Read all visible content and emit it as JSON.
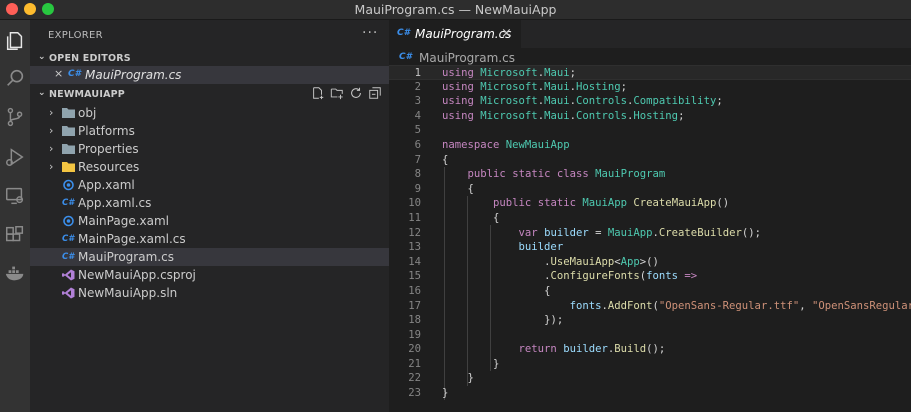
{
  "window": {
    "title": "MauiProgram.cs — NewMauiApp"
  },
  "sidebar": {
    "header": "EXPLORER",
    "more": "···",
    "open_editors": {
      "label": "OPEN EDITORS",
      "items": [
        {
          "badge": "C#",
          "name": "MauiProgram.cs"
        }
      ]
    },
    "project": {
      "label": "NEWMAUIAPP",
      "items": [
        {
          "name": "obj",
          "kind": "folder"
        },
        {
          "name": "Platforms",
          "kind": "folder"
        },
        {
          "name": "Properties",
          "kind": "folder"
        },
        {
          "name": "Resources",
          "kind": "folder-yellow"
        },
        {
          "name": "App.xaml",
          "kind": "xaml"
        },
        {
          "name": "App.xaml.cs",
          "kind": "cs",
          "badge": "C#"
        },
        {
          "name": "MainPage.xaml",
          "kind": "xaml"
        },
        {
          "name": "MainPage.xaml.cs",
          "kind": "cs",
          "badge": "C#"
        },
        {
          "name": "MauiProgram.cs",
          "kind": "cs",
          "badge": "C#",
          "selected": true
        },
        {
          "name": "NewMauiApp.csproj",
          "kind": "vs"
        },
        {
          "name": "NewMauiApp.sln",
          "kind": "vs"
        }
      ]
    }
  },
  "editor": {
    "tab": {
      "badge": "C#",
      "name": "MauiProgram.cs",
      "close": "×"
    },
    "breadcrumb": {
      "badge": "C#",
      "name": "MauiProgram.cs"
    },
    "current_line": 1,
    "lines": [
      "1",
      "2",
      "3",
      "4",
      "5",
      "6",
      "7",
      "8",
      "9",
      "10",
      "11",
      "12",
      "13",
      "14",
      "15",
      "16",
      "17",
      "18",
      "19",
      "20",
      "21",
      "22",
      "23"
    ],
    "code": {
      "l1": [
        "using",
        "Microsoft",
        ".",
        "Maui",
        ";"
      ],
      "l2": [
        "using",
        "Microsoft",
        ".",
        "Maui",
        ".",
        "Hosting",
        ";"
      ],
      "l3": [
        "using",
        "Microsoft",
        ".",
        "Maui",
        ".",
        "Controls",
        ".",
        "Compatibility",
        ";"
      ],
      "l4": [
        "using",
        "Microsoft",
        ".",
        "Maui",
        ".",
        "Controls",
        ".",
        "Hosting",
        ";"
      ],
      "l6": [
        "namespace",
        "NewMauiApp"
      ],
      "l7": "{",
      "l8": [
        "public",
        "static",
        "class",
        "MauiProgram"
      ],
      "l9": "{",
      "l10": [
        "public",
        "static",
        "MauiApp",
        "CreateMauiApp",
        "()"
      ],
      "l11": "{",
      "l12": [
        "var",
        "builder",
        " = ",
        "MauiApp",
        ".",
        "CreateBuilder",
        "();"
      ],
      "l13": "builder",
      "l14": [
        ".",
        "UseMauiApp",
        "<",
        "App",
        ">()"
      ],
      "l15": [
        ".",
        "ConfigureFonts",
        "(",
        "fonts",
        " =>"
      ],
      "l16": "{",
      "l17": [
        "fonts",
        ".",
        "AddFont",
        "(",
        "\"OpenSans-Regular.ttf\"",
        ", ",
        "\"OpenSansRegular\"",
        ");"
      ],
      "l18": "});",
      "l20": [
        "return",
        "builder",
        ".",
        "Build",
        "();"
      ],
      "l21": "}",
      "l22": "}",
      "l23": "}"
    }
  }
}
